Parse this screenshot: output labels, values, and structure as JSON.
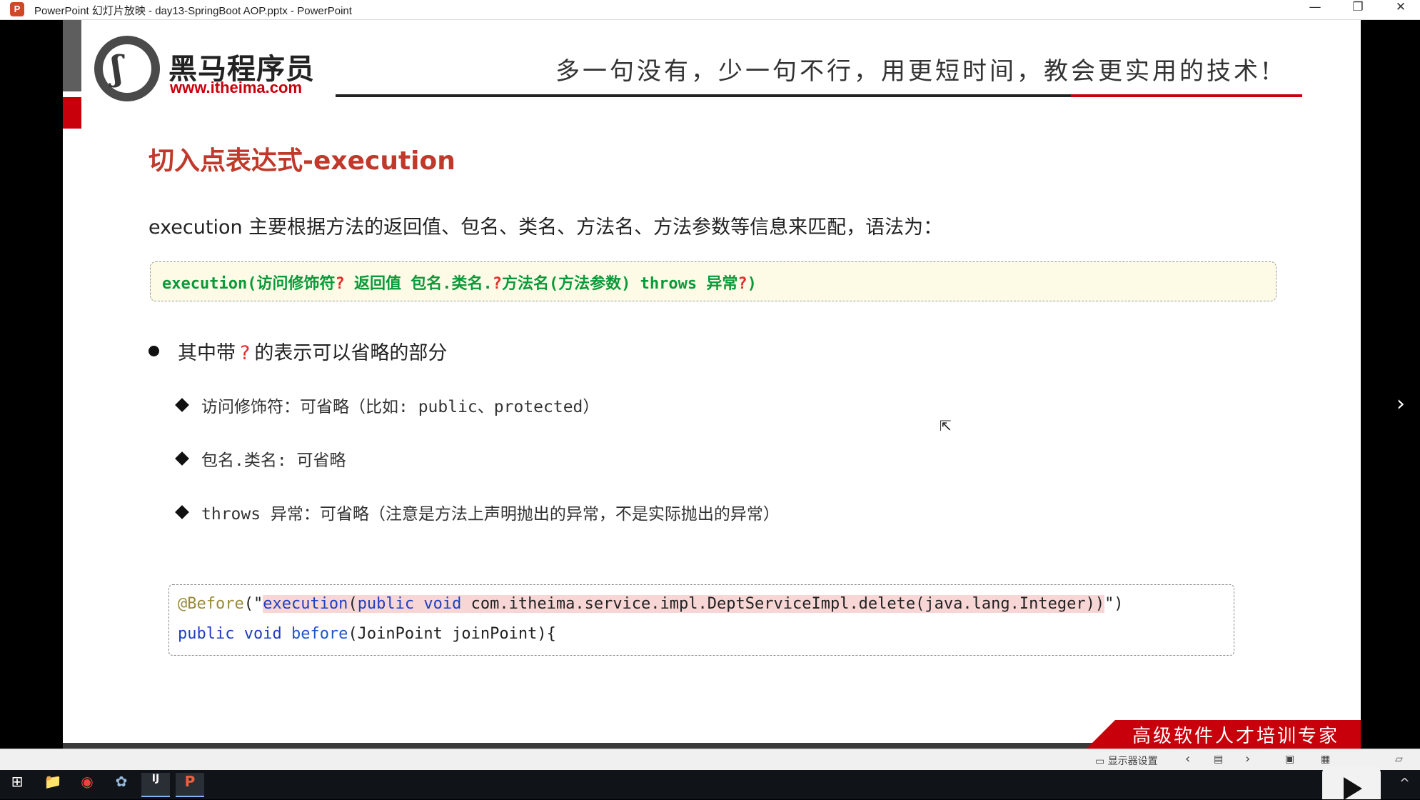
{
  "window": {
    "title": "PowerPoint 幻灯片放映 - day13-SpringBoot AOP.pptx - PowerPoint",
    "app_icon_letter": "P",
    "minimize": "—",
    "restore": "❐",
    "close": "✕"
  },
  "slide": {
    "brand_cn": "黑马程序员",
    "brand_url": "www.itheima.com",
    "slogan": "多一句没有，少一句不行，用更短时间，教会更实用的技术!",
    "title": "切入点表达式-execution",
    "intro": "execution 主要根据方法的返回值、包名、类名、方法名、方法参数等信息来匹配，语法为：",
    "syntax": {
      "part1": "execution(访问修饰符",
      "q1": "?",
      "part2": "  返回值  包名.类名.",
      "q2": "?",
      "part3": "方法名(方法参数) throws 异常",
      "q3": "?",
      "part4": ")"
    },
    "bullet": {
      "prefix": "其中带",
      "mark": "?",
      "suffix": "的表示可以省略的部分"
    },
    "sub_items": [
      "访问修饰符：可省略（比如: public、protected）",
      "包名.类名:  可省略",
      "throws 异常：可省略（注意是方法上声明抛出的异常，不是实际抛出的异常）"
    ],
    "code": {
      "annotation": "@Before",
      "open": "(\"",
      "hl_kw": "execution",
      "hl_paren": "(",
      "hl_mod": "public void",
      "hl_rest": " com.itheima.service.impl.DeptServiceImpl.delete(java.lang.Integer))",
      "close": "\")",
      "line2_kw": "public void",
      "line2_fn": "before",
      "line2_rest": "(JoinPoint joinPoint){"
    },
    "banner": "高级软件人才培训专家",
    "next_arrow": "›"
  },
  "statusbar": {
    "display_settings": "显示器设置",
    "prev": "‹",
    "next": "›"
  },
  "taskbar": {
    "start": "⊞",
    "explorer": "📁",
    "chrome": "◉",
    "app3": "✿",
    "intellij": "IJ",
    "powerpoint": "P",
    "tray": "^"
  },
  "colors": {
    "brand_red": "#c7000b",
    "title_red": "#c0392b",
    "syntax_green": "#0a9a3a",
    "syntax_bg": "#fdfbe6",
    "keyword_blue": "#1f3fbf",
    "highlight_pink": "#f8d6d6"
  }
}
